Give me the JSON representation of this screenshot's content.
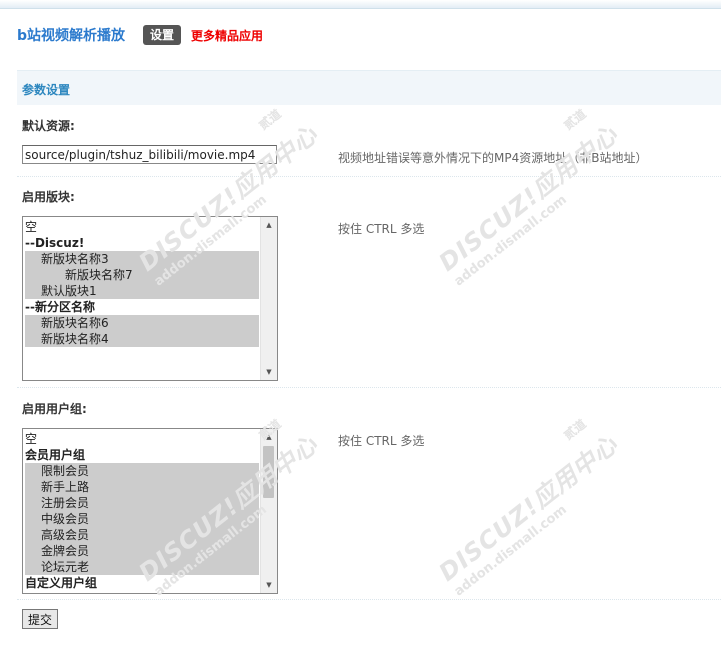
{
  "header": {
    "app_title": "b站视频解析播放",
    "tab_settings": "设置",
    "more_apps": "更多精品应用"
  },
  "section": {
    "title": "参数设置"
  },
  "fields": {
    "default_source": {
      "label": "默认资源:",
      "value": "source/plugin/tshuz_bilibili/movie.mp4",
      "hint": "视频地址错误等意外情况下的MP4资源地址（非B站地址）"
    },
    "forums": {
      "label": "启用版块:",
      "hint": "按住 CTRL 多选",
      "options": [
        {
          "text": "空",
          "indent": 0,
          "group": false,
          "selected": false
        },
        {
          "text": "--Discuz!",
          "indent": 0,
          "group": true,
          "selected": false
        },
        {
          "text": "新版块名称3",
          "indent": 1,
          "group": false,
          "selected": true
        },
        {
          "text": "新版块名称7",
          "indent": 2,
          "group": false,
          "selected": true
        },
        {
          "text": "默认版块1",
          "indent": 1,
          "group": false,
          "selected": true
        },
        {
          "text": "--新分区名称",
          "indent": 0,
          "group": true,
          "selected": false
        },
        {
          "text": "新版块名称6",
          "indent": 1,
          "group": false,
          "selected": true
        },
        {
          "text": "新版块名称4",
          "indent": 1,
          "group": false,
          "selected": true
        }
      ]
    },
    "usergroups": {
      "label": "启用用户组:",
      "hint": "按住 CTRL 多选",
      "options": [
        {
          "text": "空",
          "indent": 0,
          "group": false,
          "selected": false
        },
        {
          "text": "会员用户组",
          "indent": 0,
          "group": true,
          "selected": false
        },
        {
          "text": "限制会员",
          "indent": 1,
          "group": false,
          "selected": true
        },
        {
          "text": "新手上路",
          "indent": 1,
          "group": false,
          "selected": true
        },
        {
          "text": "注册会员",
          "indent": 1,
          "group": false,
          "selected": true
        },
        {
          "text": "中级会员",
          "indent": 1,
          "group": false,
          "selected": true
        },
        {
          "text": "高级会员",
          "indent": 1,
          "group": false,
          "selected": true
        },
        {
          "text": "金牌会员",
          "indent": 1,
          "group": false,
          "selected": true
        },
        {
          "text": "论坛元老",
          "indent": 1,
          "group": false,
          "selected": true
        },
        {
          "text": "自定义用户组",
          "indent": 0,
          "group": true,
          "selected": false
        }
      ]
    }
  },
  "submit_label": "提交",
  "watermark": {
    "brand": "DISCUZ!应用中心",
    "domain": "addon.dismall.com",
    "mark": "贰道"
  },
  "icons": {
    "scroll_up": "triangle-up-icon",
    "scroll_down": "triangle-down-icon"
  }
}
